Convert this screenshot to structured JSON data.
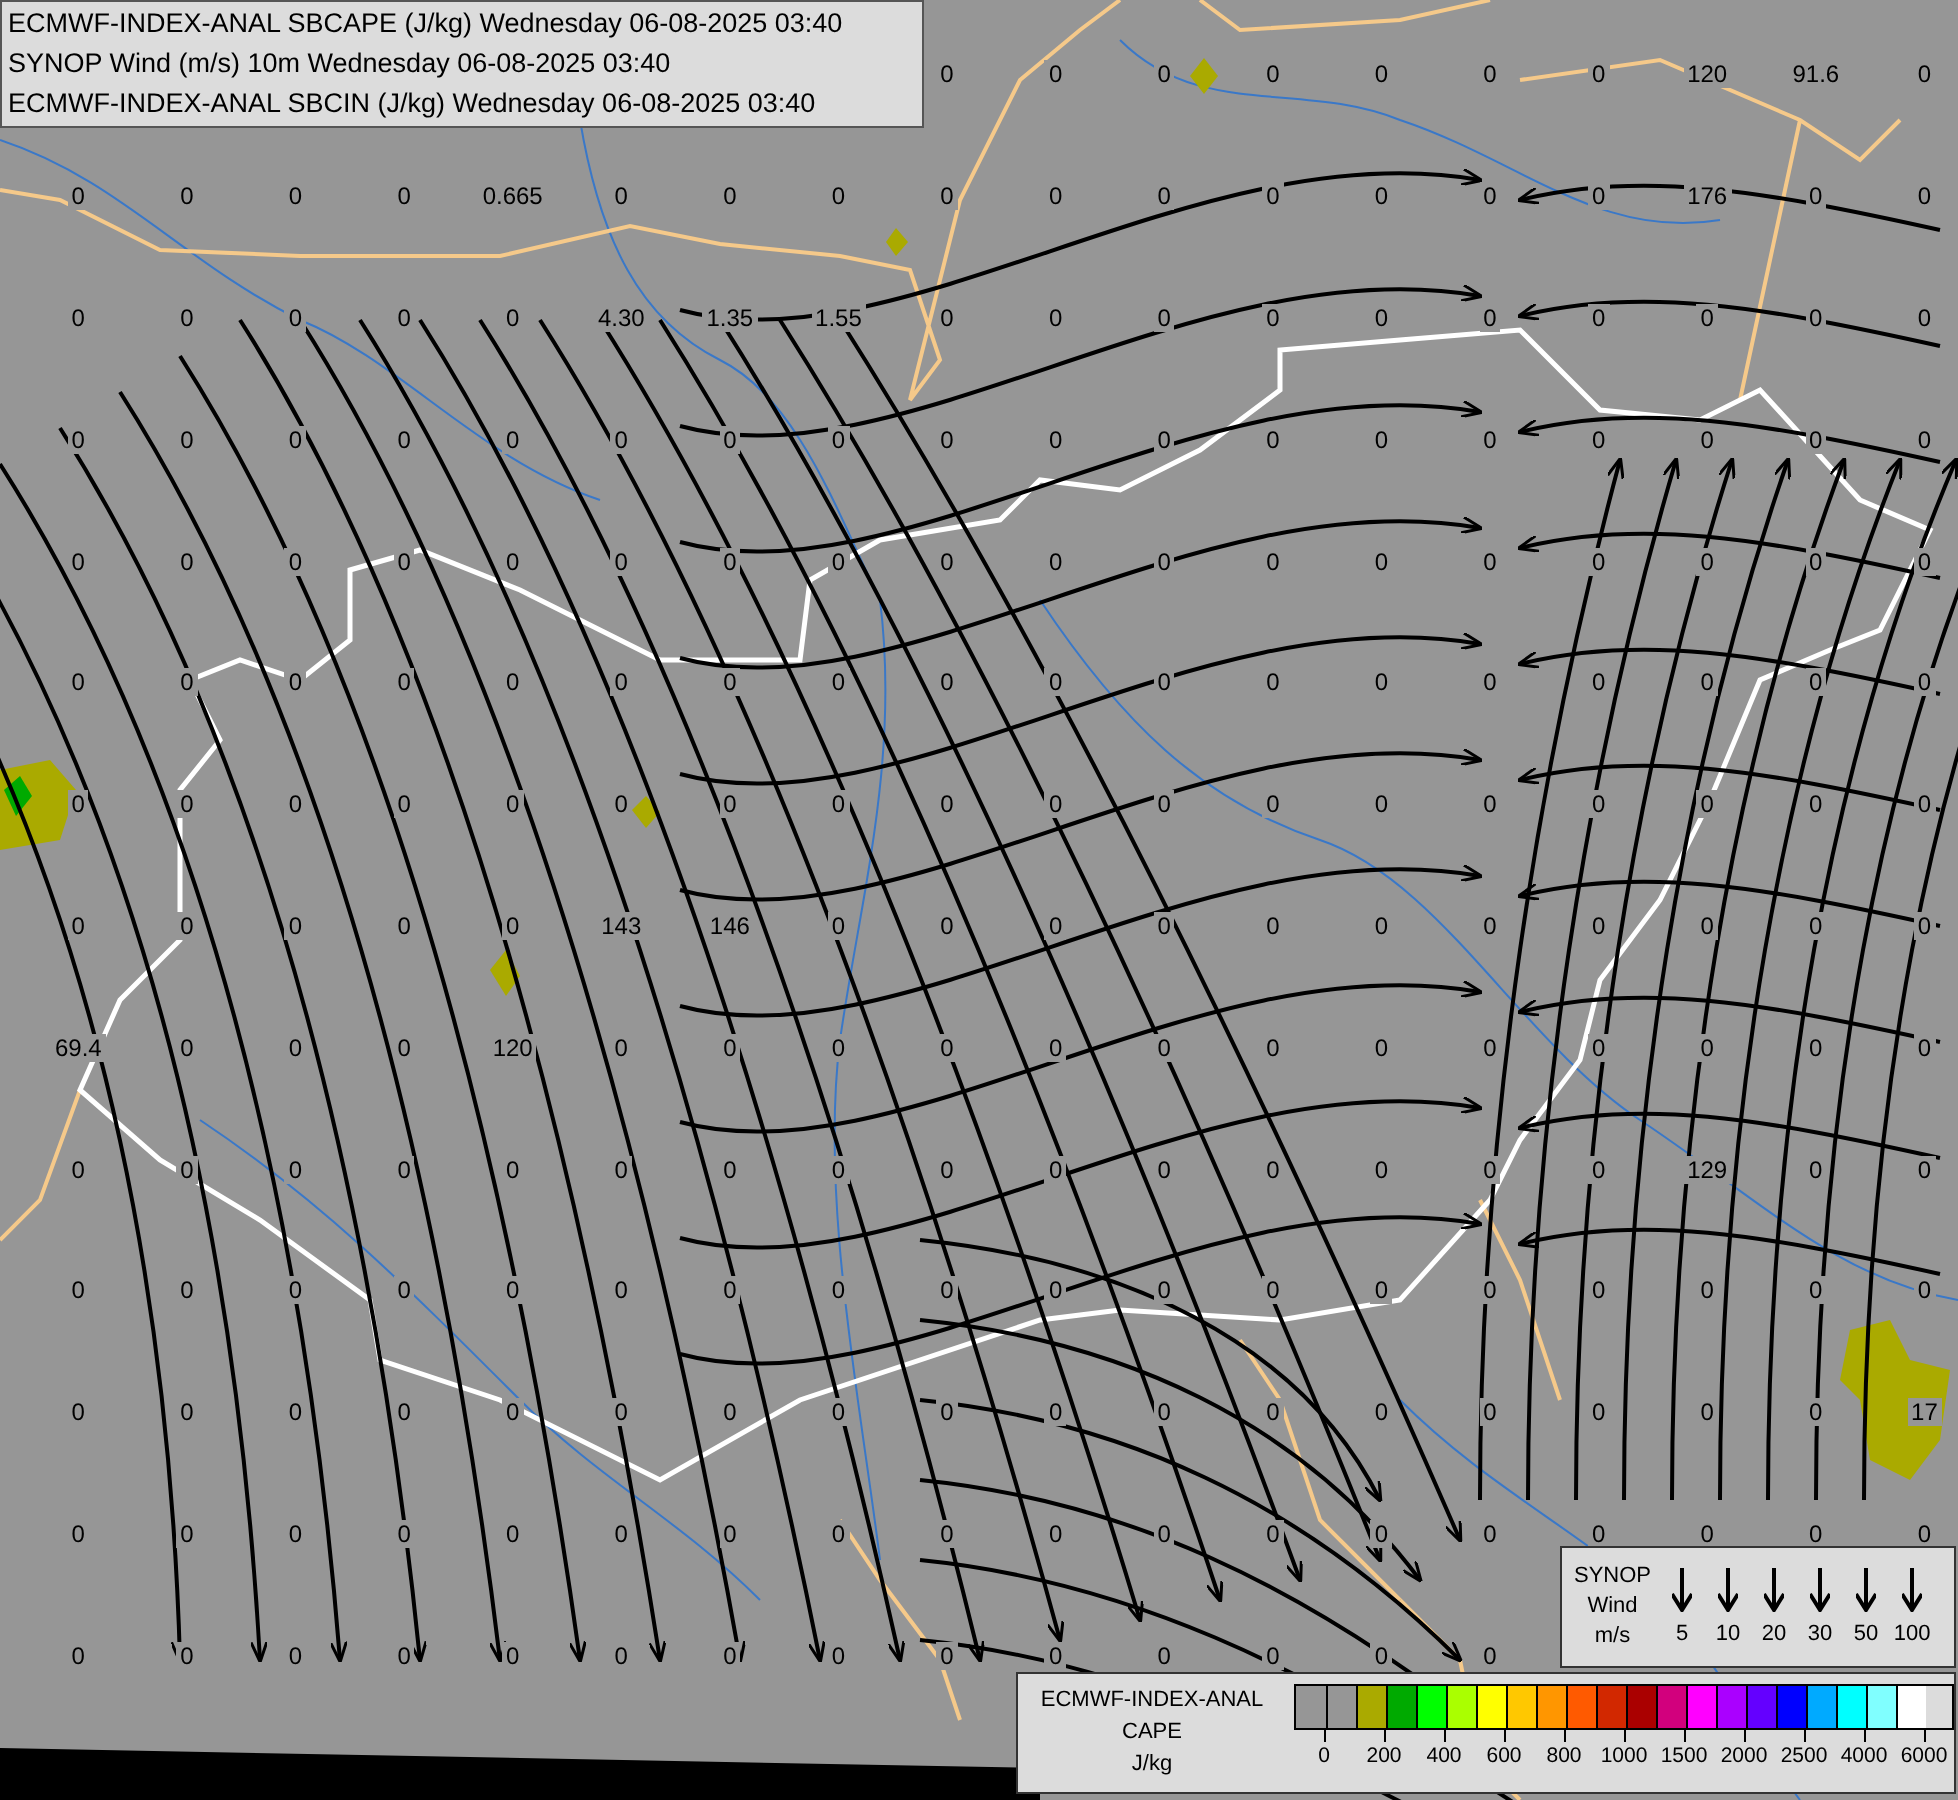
{
  "title_box": {
    "lines": [
      "ECMWF-INDEX-ANAL SBCAPE (J/kg) Wednesday 06-08-2025 03:40",
      "SYNOP Wind (m/s) 10m Wednesday 06-08-2025 03:40",
      "ECMWF-INDEX-ANAL SBCIN (J/kg) Wednesday 06-08-2025 03:40"
    ]
  },
  "map": {
    "value_rows": [
      [
        "0",
        "0",
        "0",
        "0",
        "0",
        "0",
        "0",
        "120",
        "91.6",
        "0"
      ],
      [
        "0",
        "0",
        "0",
        "0",
        "0.665",
        "0",
        "0",
        "0",
        "0",
        "0",
        "0",
        "0",
        "0",
        "0",
        "0",
        "176",
        "0",
        "0"
      ],
      [
        "0",
        "0",
        "0",
        "0",
        "0",
        "4.30",
        "1.35",
        "1.55",
        "0",
        "0",
        "0",
        "0",
        "0",
        "0",
        "0",
        "0",
        "0",
        "0"
      ],
      [
        "0",
        "0",
        "0",
        "0",
        "0",
        "0",
        "0",
        "0",
        "0",
        "0",
        "0",
        "0",
        "0",
        "0",
        "0",
        "0",
        "0",
        "0"
      ],
      [
        "0",
        "0",
        "0",
        "0",
        "0",
        "0",
        "0",
        "0",
        "0",
        "0",
        "0",
        "0",
        "0",
        "0",
        "0",
        "0",
        "0",
        "0"
      ],
      [
        "0",
        "0",
        "0",
        "0",
        "0",
        "0",
        "0",
        "0",
        "0",
        "0",
        "0",
        "0",
        "0",
        "0",
        "0",
        "0",
        "0",
        "0"
      ],
      [
        "0",
        "0",
        "0",
        "0",
        "0",
        "0",
        "0",
        "0",
        "0",
        "0",
        "0",
        "0",
        "0",
        "0",
        "0",
        "0",
        "0",
        "0"
      ],
      [
        "0",
        "0",
        "0",
        "0",
        "0",
        "143",
        "146",
        "0",
        "0",
        "0",
        "0",
        "0",
        "0",
        "0",
        "0",
        "0",
        "0",
        "0"
      ],
      [
        "69.4",
        "0",
        "0",
        "0",
        "120",
        "0",
        "0",
        "0",
        "0",
        "0",
        "0",
        "0",
        "0",
        "0",
        "0",
        "0",
        "0",
        "0"
      ],
      [
        "0",
        "0",
        "0",
        "0",
        "0",
        "0",
        "0",
        "0",
        "0",
        "0",
        "0",
        "0",
        "0",
        "0",
        "0",
        "129",
        "0",
        "0"
      ],
      [
        "0",
        "0",
        "0",
        "0",
        "0",
        "0",
        "0",
        "0",
        "0",
        "0",
        "0",
        "0",
        "0",
        "0",
        "0",
        "0",
        "0",
        "0"
      ],
      [
        "0",
        "0",
        "0",
        "0",
        "0",
        "0",
        "0",
        "0",
        "0",
        "0",
        "0",
        "0",
        "0",
        "0",
        "0",
        "0",
        "0",
        "17"
      ],
      [
        "0",
        "0",
        "0",
        "0",
        "0",
        "0",
        "0",
        "0",
        "0",
        "0",
        "0",
        "0",
        "0",
        "0",
        "0",
        "0",
        "0",
        "0"
      ],
      [
        "0",
        "0",
        "0",
        "0",
        "0",
        "0",
        "0",
        "0",
        "0",
        "0",
        "0",
        "0",
        "0",
        "0"
      ]
    ]
  },
  "wind_legend": {
    "title_lines": [
      "SYNOP",
      "Wind",
      "m/s"
    ],
    "speeds": [
      "5",
      "10",
      "20",
      "30",
      "50",
      "100"
    ]
  },
  "cape_legend": {
    "title_lines": [
      "ECMWF-INDEX-ANAL",
      "CAPE",
      "J/kg"
    ],
    "swatches": [
      {
        "color": "#969696"
      },
      {
        "color": "#969696"
      },
      {
        "color": "#aaaa00"
      },
      {
        "color": "#00aa00"
      },
      {
        "color": "#00ff00"
      },
      {
        "color": "#aaff00"
      },
      {
        "color": "#ffff00"
      },
      {
        "color": "#ffc800"
      },
      {
        "color": "#ff9600"
      },
      {
        "color": "#ff5a00"
      },
      {
        "color": "#d22800"
      },
      {
        "color": "#aa0000"
      },
      {
        "color": "#d2007d"
      },
      {
        "color": "#ff00ff"
      },
      {
        "color": "#aa00ff"
      },
      {
        "color": "#6400ff"
      },
      {
        "color": "#0000ff"
      },
      {
        "color": "#00aaff"
      },
      {
        "color": "#00ffff"
      },
      {
        "color": "#80ffff"
      },
      {
        "color": "#ffffff"
      }
    ],
    "ticks": [
      "0",
      "200",
      "400",
      "600",
      "800",
      "1000",
      "1500",
      "2000",
      "2500",
      "4000",
      "6000"
    ]
  }
}
